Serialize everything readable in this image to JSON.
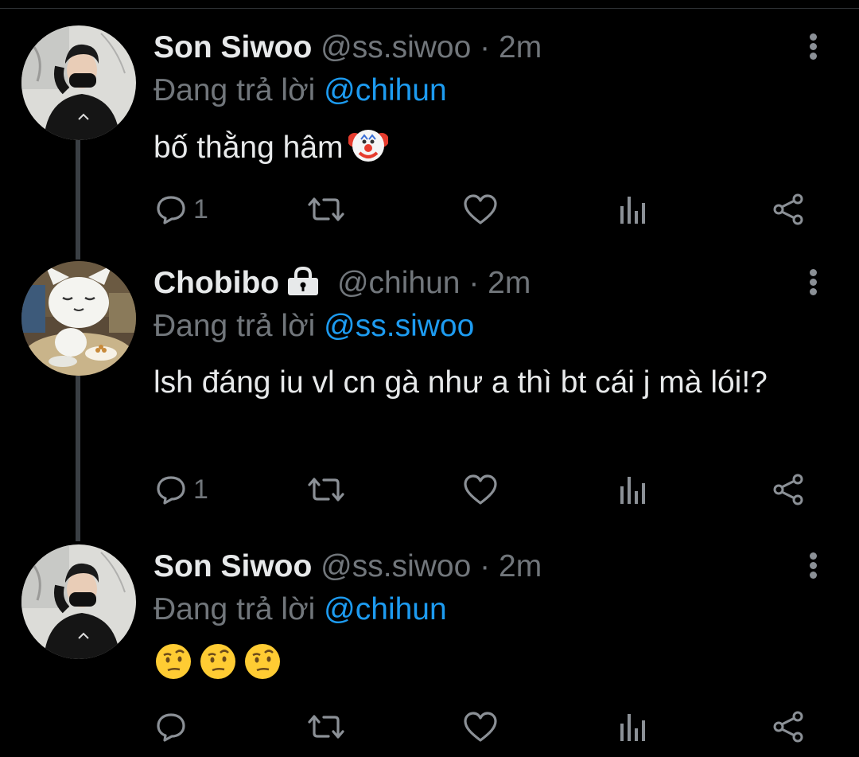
{
  "tweets": [
    {
      "name": "Son Siwoo",
      "handle": "@ss.siwoo",
      "time": "2m",
      "reply_prefix": "Đang trả lời",
      "reply_to": "@chihun",
      "text": "bố thằng hâm",
      "emojis": [
        "clown-face"
      ],
      "reply_count": "1",
      "protected": false
    },
    {
      "name": "Chobibo",
      "handle": "@chihun",
      "time": "2m",
      "reply_prefix": "Đang trả lời",
      "reply_to": "@ss.siwoo",
      "text": "lsh đáng iu vl cn gà như a thì bt cái j mà lói!?",
      "emojis": [],
      "reply_count": "1",
      "protected": true
    },
    {
      "name": "Son Siwoo",
      "handle": "@ss.siwoo",
      "time": "2m",
      "reply_prefix": "Đang trả lời",
      "reply_to": "@chihun",
      "text": "",
      "emojis": [
        "face-with-raised-eyebrow",
        "face-with-raised-eyebrow",
        "face-with-raised-eyebrow"
      ],
      "reply_count": "",
      "protected": false
    }
  ],
  "separator": "·",
  "icons": [
    "reply-icon",
    "retweet-icon",
    "like-icon",
    "analytics-icon",
    "share-icon",
    "more-icon",
    "lock-icon"
  ],
  "colors": {
    "background": "#000000",
    "text": "#e7e9ea",
    "secondary": "#71767b",
    "mention": "#1d9bf0"
  }
}
